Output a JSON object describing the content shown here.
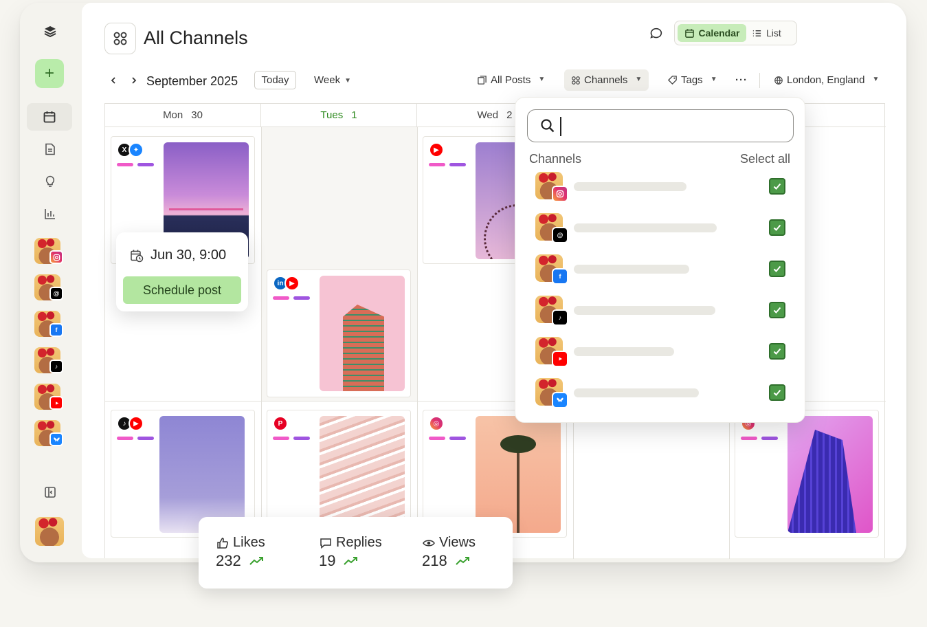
{
  "header": {
    "title": "All Channels",
    "view_calendar": "Calendar",
    "view_list": "List"
  },
  "toolbar": {
    "month": "September 2025",
    "today": "Today",
    "range": "Week",
    "all_posts": "All Posts",
    "channels": "Channels",
    "tags": "Tags",
    "more": "···",
    "location": "London, England"
  },
  "calendar": {
    "days": [
      {
        "name": "Mon",
        "num": "30"
      },
      {
        "name": "Tues",
        "num": "1"
      },
      {
        "name": "Wed",
        "num": "2"
      }
    ]
  },
  "sidebar": {
    "channels": [
      "instagram",
      "threads",
      "facebook",
      "tiktok",
      "youtube",
      "bluesky"
    ]
  },
  "schedule_popup": {
    "date": "Jun 30, 9:00",
    "button": "Schedule post"
  },
  "channels_dropdown": {
    "search_placeholder": "",
    "label": "Channels",
    "select_all": "Select all",
    "items": [
      {
        "network": "instagram",
        "checked": true
      },
      {
        "network": "threads",
        "checked": true
      },
      {
        "network": "facebook",
        "checked": true
      },
      {
        "network": "tiktok",
        "checked": true
      },
      {
        "network": "youtube",
        "checked": true
      },
      {
        "network": "bluesky",
        "checked": true
      }
    ]
  },
  "stats": {
    "likes_label": "Likes",
    "likes_value": "232",
    "replies_label": "Replies",
    "replies_value": "19",
    "views_label": "Views",
    "views_value": "218"
  },
  "colors": {
    "accent_green": "#b9ecaa",
    "today_text": "#2e8a1f",
    "checkbox": "#4c9a48",
    "bar_pink": "#f05ac8",
    "bar_purple": "#9f55e0"
  }
}
